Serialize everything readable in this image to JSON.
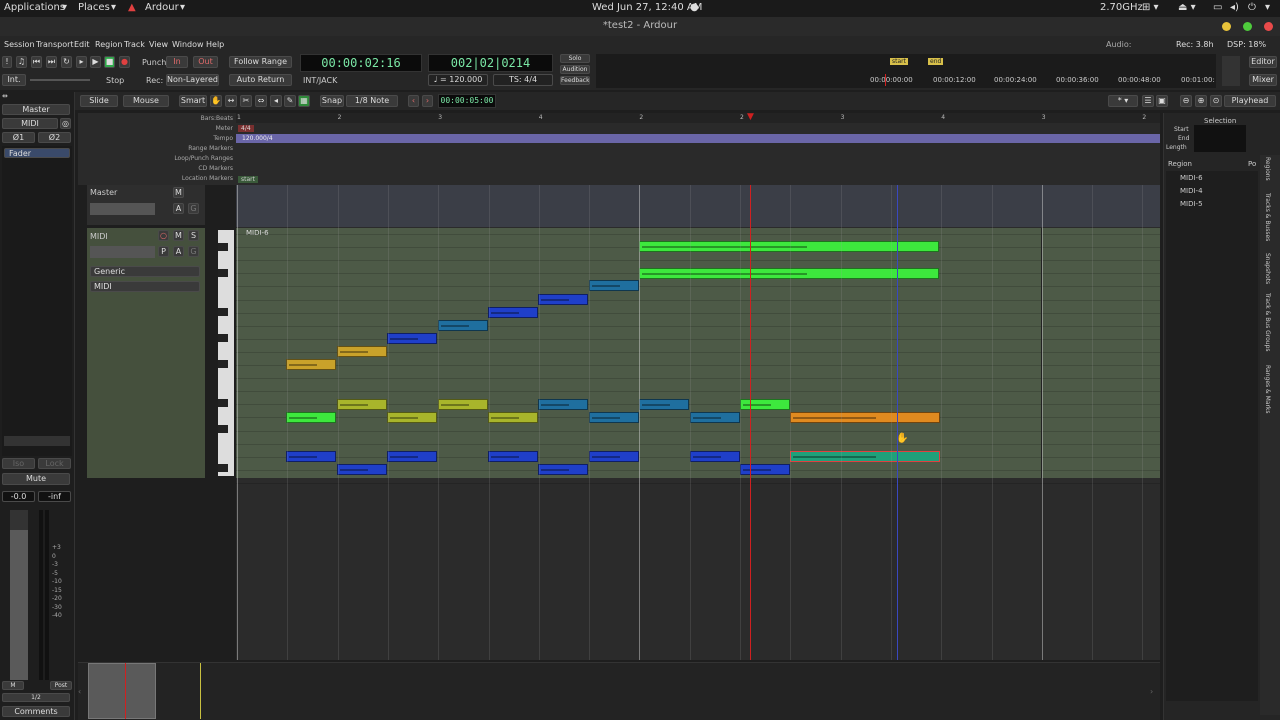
{
  "gnome": {
    "applications": "Applications",
    "places": "Places",
    "app": "Ardour",
    "clock": "Wed Jun 27, 12:40 AM",
    "cpu": "2.70GHz"
  },
  "window": {
    "title": "*test2 - Ardour"
  },
  "menu": [
    "Session",
    "Transport",
    "Edit",
    "Region",
    "Track",
    "View",
    "Window",
    "Help"
  ],
  "status": {
    "audio": "Audio:",
    "rec": "Rec: 3.8h",
    "dsp": "DSP: 18%"
  },
  "toolbar": {
    "punch": "Punch:",
    "in": "In",
    "out": "Out",
    "follow_range": "Follow Range",
    "stop": "Stop",
    "rec": "Rec:",
    "non_layered": "Non-Layered",
    "auto_return": "Auto Return",
    "int": "Int.",
    "clock_primary": "00:00:02:16",
    "clock_secondary": "002|02|0214",
    "jack": "INT/JACK",
    "tempo": "♩ = 120.000",
    "ts": "TS: 4/4",
    "solo": "Solo",
    "audition": "Audition",
    "feedback": "Feedback",
    "editor": "Editor",
    "mixer": "Mixer"
  },
  "minitimeline": {
    "start": "start",
    "end": "end",
    "times": [
      "00:00:00:00",
      "00:00:12:00",
      "00:00:24:00",
      "00:00:36:00",
      "00:00:48:00",
      "00:01:00:"
    ]
  },
  "edit_toolbar": {
    "mode": "Slide",
    "mouse": "Mouse",
    "smart": "Smart",
    "snap": "Snap",
    "grid": "1/8 Note",
    "nudge": "00:00:05:00",
    "zoom_focus": "Playhead"
  },
  "rulers": {
    "labels": [
      "Bars:Beats",
      "Meter",
      "Tempo",
      "Range Markers",
      "Loop/Punch Ranges",
      "CD Markers",
      "Location Markers"
    ],
    "meter": "4/4",
    "tempo": "120.000/4",
    "location": "start",
    "bars": [
      "1",
      "2",
      "3",
      "4",
      "2",
      "2",
      "3",
      "4",
      "3",
      "2"
    ]
  },
  "tracks": {
    "master": {
      "name": "Master",
      "m": "M",
      "a": "A",
      "g": "G"
    },
    "midi": {
      "name": "MIDI",
      "m": "M",
      "s": "S",
      "p": "P",
      "a": "A",
      "g": "G",
      "instrument": "Generic",
      "channel": "MIDI",
      "region": "MIDI-6"
    }
  },
  "strip": {
    "name": "Master",
    "midi": "MIDI",
    "phase1": "Ø1",
    "phase2": "Ø2",
    "fader": "Fader",
    "iso": "Iso",
    "lock": "Lock",
    "mute": "Mute",
    "gain": "-0.0",
    "peak": "-inf",
    "m": "M",
    "post": "Post",
    "ratio": "1/2",
    "comments": "Comments",
    "scale": [
      "+3",
      "0",
      "-3",
      "-5",
      "-10",
      "-15",
      "-20",
      "-30",
      "-40"
    ]
  },
  "right_panel": {
    "selection": "Selection",
    "start": "Start",
    "end": "End",
    "length": "Length",
    "col_region": "Region",
    "col_pos": "Po",
    "regions": [
      "MIDI-6",
      "MIDI-4",
      "MIDI-5"
    ],
    "tabs": [
      "Regions",
      "Tracks & Busses",
      "Snapshots",
      "Track & Bus Groups",
      "Ranges & Marks"
    ]
  },
  "colors": {
    "blue": "#1f3fc9",
    "teal": "#1f6f9f",
    "green": "#3de83d",
    "olive": "#a8b52b",
    "gold": "#c9a22a",
    "orange": "#e08a1f",
    "seagreen": "#1fa07a",
    "playhead": "#d02020"
  }
}
